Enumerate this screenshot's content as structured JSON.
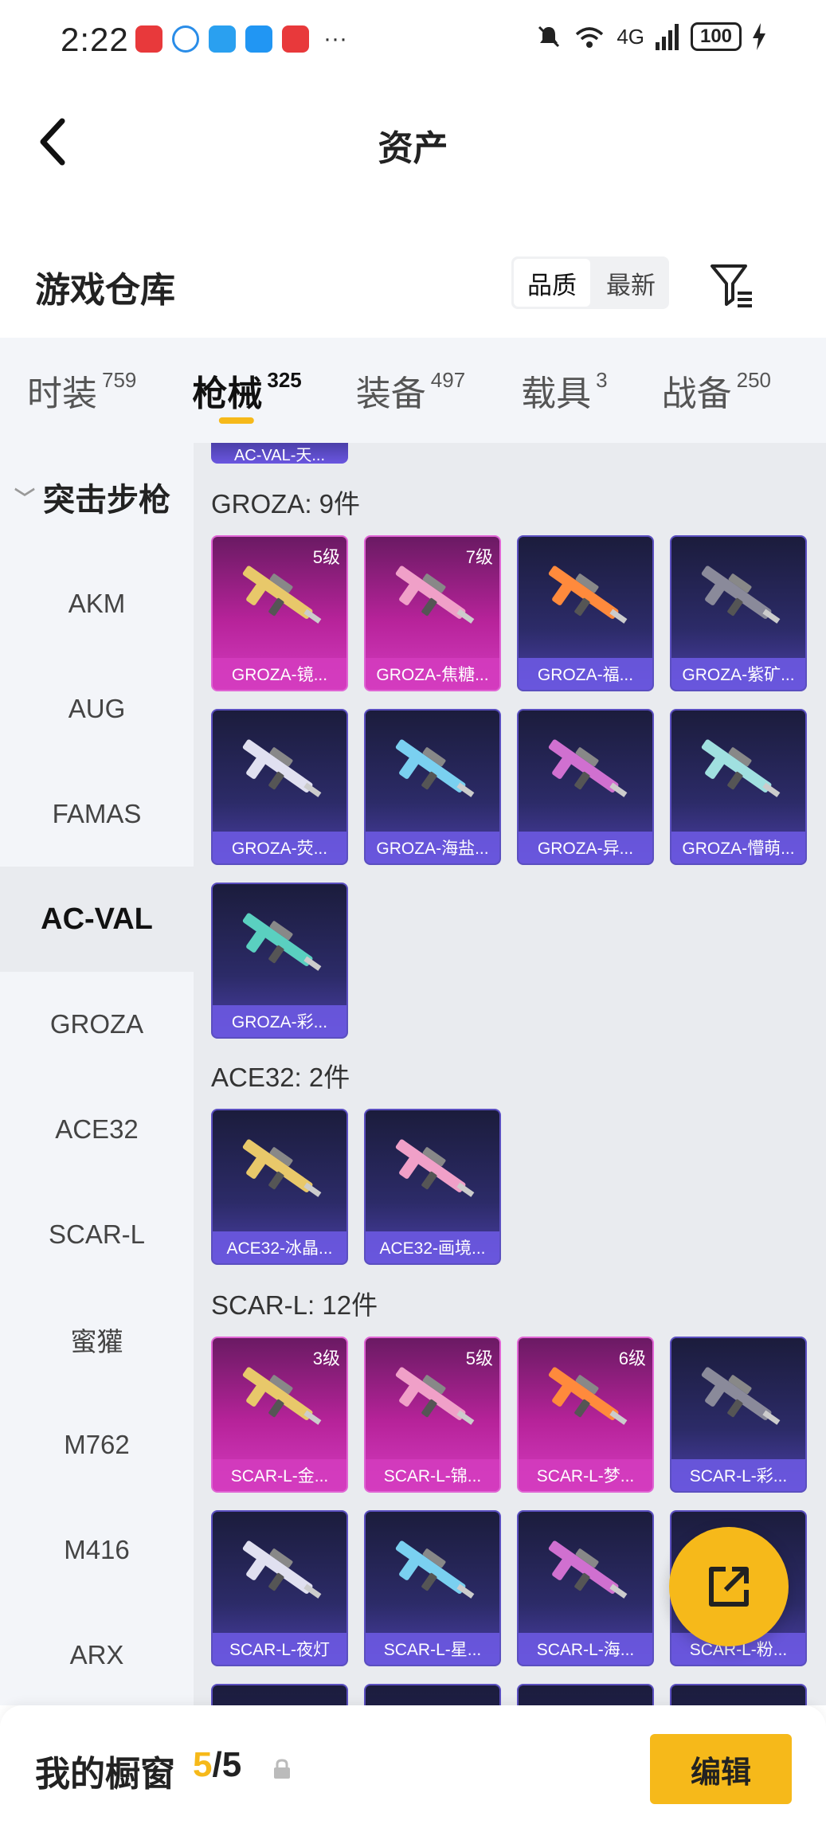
{
  "status_bar": {
    "time": "2:22",
    "network_label": "4G",
    "battery": "100",
    "more": "···"
  },
  "header": {
    "title": "资产"
  },
  "warehouse": {
    "title": "游戏仓库",
    "sort_options": [
      "品质",
      "最新"
    ],
    "active_sort": "品质"
  },
  "category_tabs": [
    {
      "label": "时装",
      "count": "759"
    },
    {
      "label": "枪械",
      "count": "325",
      "active": true
    },
    {
      "label": "装备",
      "count": "497"
    },
    {
      "label": "载具",
      "count": "3"
    },
    {
      "label": "战备",
      "count": "250"
    }
  ],
  "sidebar": {
    "group_label": "突击步枪",
    "items": [
      "AKM",
      "AUG",
      "FAMAS",
      "AC-VAL",
      "GROZA",
      "ACE32",
      "SCAR-L",
      "蜜獾",
      "M762",
      "M416",
      "ARX"
    ],
    "active_item": "AC-VAL"
  },
  "content": {
    "partial_top_label": "AC-VAL-天...",
    "sections": [
      {
        "title": "GROZA: 9件",
        "items": [
          {
            "name": "GROZA-镜...",
            "level": "5级",
            "rarity": "pink"
          },
          {
            "name": "GROZA-焦糖...",
            "level": "7级",
            "rarity": "pink"
          },
          {
            "name": "GROZA-福...",
            "level": "",
            "rarity": "purple"
          },
          {
            "name": "GROZA-紫矿...",
            "level": "",
            "rarity": "purple"
          },
          {
            "name": "GROZA-荧...",
            "level": "",
            "rarity": "purple"
          },
          {
            "name": "GROZA-海盐...",
            "level": "",
            "rarity": "purple"
          },
          {
            "name": "GROZA-异...",
            "level": "",
            "rarity": "purple"
          },
          {
            "name": "GROZA-懵萌...",
            "level": "",
            "rarity": "purple"
          },
          {
            "name": "GROZA-彩...",
            "level": "",
            "rarity": "purple"
          }
        ]
      },
      {
        "title": "ACE32: 2件",
        "items": [
          {
            "name": "ACE32-冰晶...",
            "level": "",
            "rarity": "purple"
          },
          {
            "name": "ACE32-画境...",
            "level": "",
            "rarity": "purple"
          }
        ]
      },
      {
        "title": "SCAR-L: 12件",
        "items": [
          {
            "name": "SCAR-L-金...",
            "level": "3级",
            "rarity": "pink"
          },
          {
            "name": "SCAR-L-锦...",
            "level": "5级",
            "rarity": "pink"
          },
          {
            "name": "SCAR-L-梦...",
            "level": "6级",
            "rarity": "pink"
          },
          {
            "name": "SCAR-L-彩...",
            "level": "",
            "rarity": "purple"
          },
          {
            "name": "SCAR-L-夜灯",
            "level": "",
            "rarity": "purple"
          },
          {
            "name": "SCAR-L-星...",
            "level": "",
            "rarity": "purple"
          },
          {
            "name": "SCAR-L-海...",
            "level": "",
            "rarity": "purple"
          },
          {
            "name": "SCAR-L-粉...",
            "level": "",
            "rarity": "purple"
          }
        ]
      }
    ]
  },
  "bottom_bar": {
    "title": "我的橱窗",
    "current": "5",
    "separator": "/",
    "total": "5",
    "edit_label": "编辑"
  },
  "colors": {
    "accent": "#f6b91a",
    "purple_card": "#4b3fa8",
    "pink_card": "#d43cc0"
  }
}
